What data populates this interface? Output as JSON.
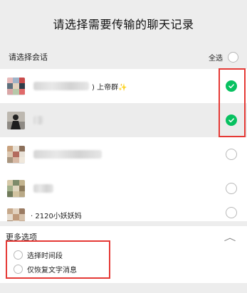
{
  "header": {
    "title": "请选择需要传输的聊天记录"
  },
  "section": {
    "label": "请选择会话",
    "select_all": "全选"
  },
  "chats": [
    {
      "name_suffix": ") 上帝群✨",
      "selected": true
    },
    {
      "name_suffix": "",
      "selected": true
    },
    {
      "name_suffix": "",
      "selected": false
    },
    {
      "name_suffix": "",
      "selected": false
    },
    {
      "name_suffix": "· 2120小妖妖妈",
      "selected": false
    }
  ],
  "more_options": {
    "label": "更多选项",
    "options": [
      {
        "label": "选择时间段"
      },
      {
        "label": "仅恢复文字消息"
      }
    ]
  },
  "colors": {
    "accent": "#07c160",
    "highlight": "#e53935"
  },
  "icons": {
    "checked": "checkmark-circle-icon",
    "unchecked": "empty-circle-icon",
    "collapse": "chevron-up-icon"
  }
}
